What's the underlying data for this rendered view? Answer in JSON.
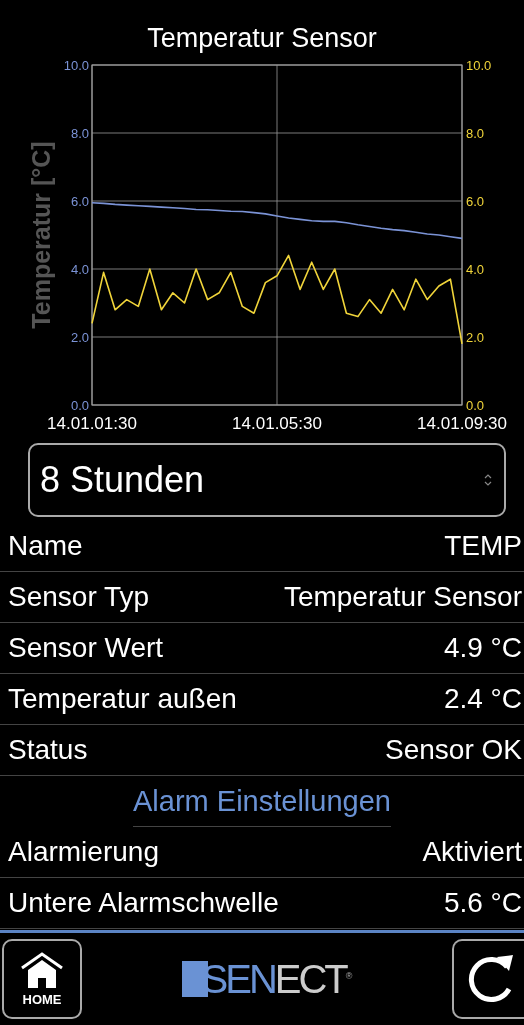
{
  "title": "Temperatur Sensor",
  "chart": {
    "chart_data": {
      "type": "line",
      "grid": true,
      "ylabel": "Temperatur [°C]",
      "ylim": [
        0,
        10
      ],
      "yticks": [
        {
          "value": 0,
          "label": "0.0"
        },
        {
          "value": 2,
          "label": "2.0"
        },
        {
          "value": 4,
          "label": "4.0"
        },
        {
          "value": 6,
          "label": "6.0"
        },
        {
          "value": 8,
          "label": "8.0"
        },
        {
          "value": 10,
          "label": "10.0"
        }
      ],
      "categories": [
        "14.01.01:30",
        null,
        null,
        null,
        null,
        null,
        null,
        null,
        null,
        null,
        null,
        null,
        null,
        null,
        null,
        null,
        "14.01.05:30",
        null,
        null,
        null,
        null,
        null,
        null,
        null,
        null,
        null,
        null,
        null,
        null,
        null,
        null,
        null,
        "14.01.09:30"
      ],
      "series": [
        {
          "color": "#7b93d6",
          "values": [
            5.95,
            5.93,
            5.9,
            5.88,
            5.86,
            5.84,
            5.82,
            5.8,
            5.78,
            5.75,
            5.74,
            5.72,
            5.7,
            5.69,
            5.66,
            5.62,
            5.56,
            5.5,
            5.46,
            5.42,
            5.4,
            5.4,
            5.36,
            5.3,
            5.25,
            5.2,
            5.16,
            5.13,
            5.08,
            5.03,
            5.0,
            4.95,
            4.9
          ]
        },
        {
          "color": "#f0d43a",
          "values": [
            2.4,
            3.9,
            2.8,
            3.1,
            2.9,
            4.0,
            2.8,
            3.3,
            3.0,
            4.0,
            3.1,
            3.3,
            3.9,
            2.9,
            2.7,
            3.6,
            3.8,
            4.4,
            3.4,
            4.2,
            3.4,
            4.0,
            2.7,
            2.6,
            3.1,
            2.7,
            3.4,
            2.8,
            3.7,
            3.1,
            3.5,
            3.7,
            1.8
          ]
        }
      ]
    }
  },
  "range_select": {
    "value": "8 Stunden"
  },
  "rows": [
    {
      "kind": "row",
      "label": "Name",
      "value": "TEMP"
    },
    {
      "kind": "row",
      "label": "Sensor Typ",
      "value": "Temperatur Sensor"
    },
    {
      "kind": "row",
      "label": "Sensor Wert",
      "value": "4.9 °C"
    },
    {
      "kind": "row",
      "label": "Temperatur außen",
      "value": "2.4 °C"
    },
    {
      "kind": "row",
      "label": "Status",
      "value": "Sensor OK"
    },
    {
      "kind": "header",
      "label": "Alarm Einstellungen"
    },
    {
      "kind": "row",
      "label": "Alarmierung",
      "value": "Aktiviert"
    },
    {
      "kind": "row",
      "label": "Untere Alarmschwelle",
      "value": "5.6 °C"
    }
  ],
  "bottom_bar": {
    "home_label": "HOME",
    "logo": {
      "parts": [
        "SEN",
        "ECT"
      ],
      "mark": "®"
    }
  }
}
